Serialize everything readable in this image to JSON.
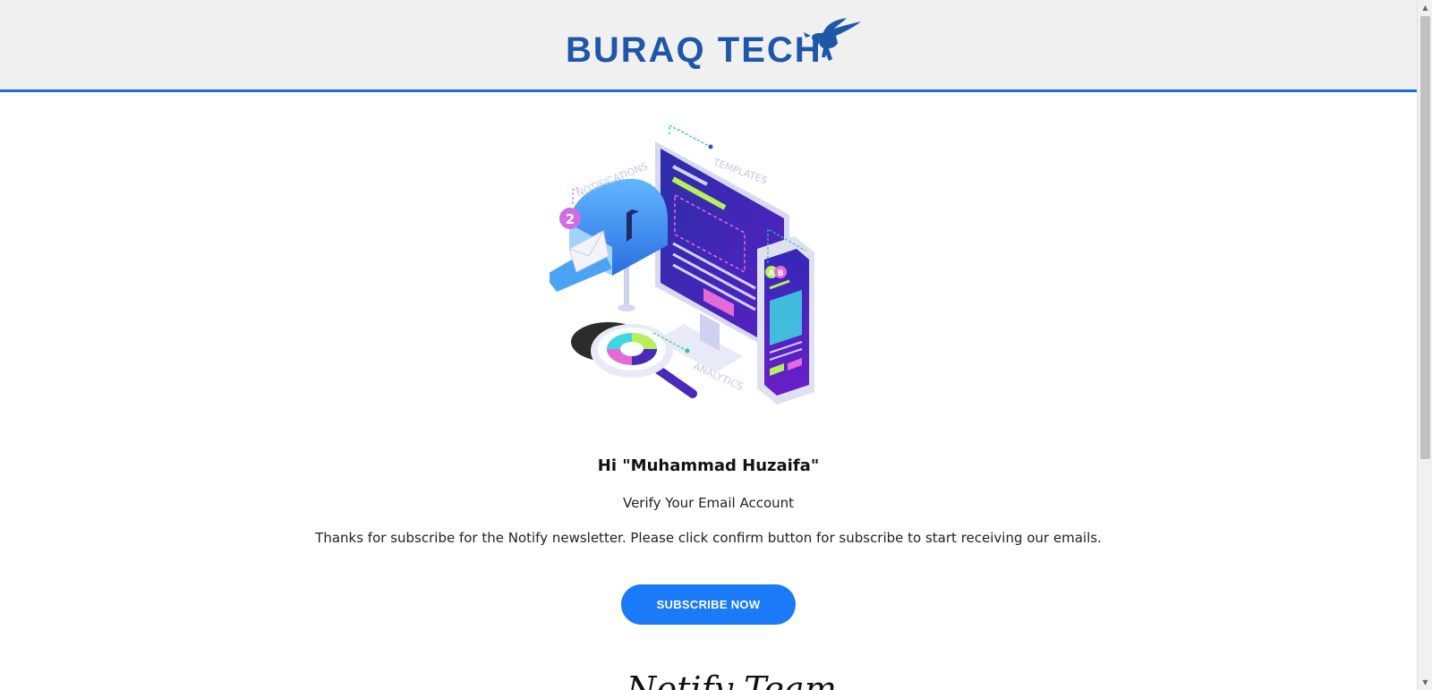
{
  "header": {
    "logo_text": "BURAQ TECH",
    "accent_color": "#1b6ed6"
  },
  "illustration": {
    "labels": {
      "notifications": "NOTIFICATIONS",
      "templates": "TEMPLATES",
      "analytics": "ANALYTICS",
      "badge_count": "2",
      "ab_a": "A",
      "ab_b": "B"
    },
    "icons": [
      "mailbox-icon",
      "monitor-icon",
      "smartphone-icon",
      "magnifier-icon",
      "pie-chart-icon"
    ]
  },
  "content": {
    "greeting": "Hi \"Muhammad Huzaifa\"",
    "subtitle": "Verify Your Email Account",
    "message": "Thanks for subscribe for the Notify newsletter. Please click confirm button for subscribe to start receiving our emails.",
    "button_label": "SUBSCRIBE NOW",
    "button_color": "#1a7af8",
    "signature": "Notify Team"
  },
  "scrollbar": {
    "up_icon": "scroll-up-arrow-icon",
    "down_icon": "scroll-down-arrow-icon"
  }
}
